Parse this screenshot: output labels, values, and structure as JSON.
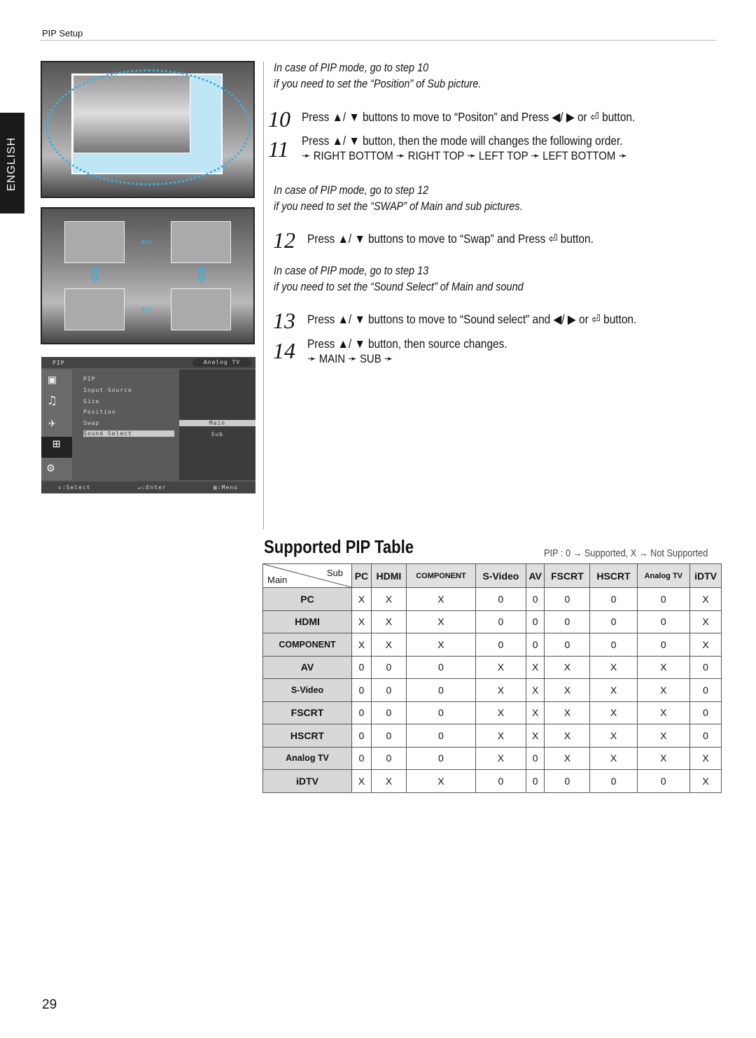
{
  "header": "PIP Setup",
  "side_tab": "ENGLISH",
  "page_number": "29",
  "intro1": [
    "In case of PIP mode, go to step 10",
    "if you need to set the “Position” of Sub picture."
  ],
  "intro2": [
    "In case of PIP mode, go to step 12",
    "if you need to set the “SWAP” of Main and sub pictures."
  ],
  "intro3": [
    "In case of PIP mode, go to step 13",
    "if you need to set the “Sound Select” of Main and sound"
  ],
  "steps": [
    {
      "n": "10",
      "text": "Press ▲/ ▼ buttons to move to “Positon” and Press ◀/ ▶ or ⏎ button."
    },
    {
      "n": "11",
      "text": "Press ▲/ ▼ button, then the mode will changes the following order.",
      "seq": "➛ RIGHT BOTTOM ➛ RIGHT TOP ➛ LEFT TOP ➛ LEFT BOTTOM ➛"
    },
    {
      "n": "12",
      "text": "Press ▲/ ▼ buttons to move to “Swap” and Press ⏎ button."
    },
    {
      "n": "13",
      "text": "Press ▲/ ▼ buttons to move to “Sound select” and ◀/ ▶ or ⏎ button."
    },
    {
      "n": "14",
      "text": "Press ▲/ ▼ button, then source changes.",
      "seq": "➛ MAIN ➛ SUB ➛"
    }
  ],
  "osd": {
    "title": "PIP",
    "source": "Analog TV",
    "items": [
      "PIP",
      "Input Source",
      "Size",
      "Position",
      "Swap",
      "Sound Select"
    ],
    "options": [
      "Main",
      "Sub"
    ],
    "footer": [
      "⇕:Select",
      "↵:Enter",
      "▥:Menu"
    ]
  },
  "table": {
    "title": "Supported PIP Table",
    "legend": "PIP : 0 → Supported,  X → Not Supported",
    "corner_sub": "Sub",
    "corner_main": "Main",
    "columns": [
      "PC",
      "HDMI",
      "COMPONENT",
      "S-Video",
      "AV",
      "FSCRT",
      "HSCRT",
      "Analog TV",
      "iDTV"
    ],
    "rows": [
      {
        "name": "PC",
        "cells": [
          "X",
          "X",
          "X",
          "0",
          "0",
          "0",
          "0",
          "0",
          "X"
        ]
      },
      {
        "name": "HDMI",
        "cells": [
          "X",
          "X",
          "X",
          "0",
          "0",
          "0",
          "0",
          "0",
          "X"
        ]
      },
      {
        "name": "COMPONENT",
        "cells": [
          "X",
          "X",
          "X",
          "0",
          "0",
          "0",
          "0",
          "0",
          "X"
        ]
      },
      {
        "name": "AV",
        "cells": [
          "0",
          "0",
          "0",
          "X",
          "X",
          "X",
          "X",
          "X",
          "0"
        ]
      },
      {
        "name": "S-Video",
        "cells": [
          "0",
          "0",
          "0",
          "X",
          "X",
          "X",
          "X",
          "X",
          "0"
        ]
      },
      {
        "name": "FSCRT",
        "cells": [
          "0",
          "0",
          "0",
          "X",
          "X",
          "X",
          "X",
          "X",
          "0"
        ]
      },
      {
        "name": "HSCRT",
        "cells": [
          "0",
          "0",
          "0",
          "X",
          "X",
          "X",
          "X",
          "X",
          "0"
        ]
      },
      {
        "name": "Analog TV",
        "cells": [
          "0",
          "0",
          "0",
          "X",
          "0",
          "X",
          "X",
          "X",
          "X"
        ]
      },
      {
        "name": "iDTV",
        "cells": [
          "X",
          "X",
          "X",
          "0",
          "0",
          "0",
          "0",
          "0",
          "X"
        ]
      }
    ]
  }
}
